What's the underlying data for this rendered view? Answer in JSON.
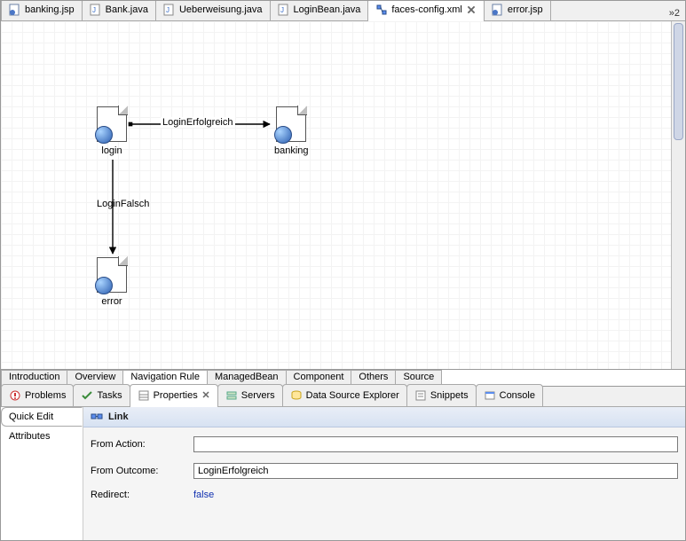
{
  "editorTabs": {
    "overflow": "2",
    "items": [
      {
        "label": "banking.jsp",
        "icon": "jsp-icon",
        "active": false,
        "hasClose": false
      },
      {
        "label": "Bank.java",
        "icon": "java-icon",
        "active": false,
        "hasClose": false
      },
      {
        "label": "Ueberweisung.java",
        "icon": "java-icon",
        "active": false,
        "hasClose": false
      },
      {
        "label": "LoginBean.java",
        "icon": "java-icon",
        "active": false,
        "hasClose": false
      },
      {
        "label": "faces-config.xml",
        "icon": "faces-icon",
        "active": true,
        "hasClose": true
      },
      {
        "label": "error.jsp",
        "icon": "jsp-icon",
        "active": false,
        "hasClose": false
      }
    ]
  },
  "diagram": {
    "nodes": {
      "login": {
        "label": "login"
      },
      "banking": {
        "label": "banking"
      },
      "error": {
        "label": "error"
      }
    },
    "edges": {
      "loginToBanking": {
        "label": "LoginErfolgreich"
      },
      "loginToError": {
        "label": "LoginFalsch"
      }
    }
  },
  "subTabs": [
    {
      "label": "Introduction",
      "active": false
    },
    {
      "label": "Overview",
      "active": false
    },
    {
      "label": "Navigation Rule",
      "active": true
    },
    {
      "label": "ManagedBean",
      "active": false
    },
    {
      "label": "Component",
      "active": false
    },
    {
      "label": "Others",
      "active": false
    },
    {
      "label": "Source",
      "active": false
    }
  ],
  "viewTabs": [
    {
      "label": "Problems",
      "icon": "problems-icon",
      "active": false
    },
    {
      "label": "Tasks",
      "icon": "tasks-icon",
      "active": false
    },
    {
      "label": "Properties",
      "icon": "properties-icon",
      "active": true,
      "hasClose": true
    },
    {
      "label": "Servers",
      "icon": "servers-icon",
      "active": false
    },
    {
      "label": "Data Source Explorer",
      "icon": "dse-icon",
      "active": false
    },
    {
      "label": "Snippets",
      "icon": "snippets-icon",
      "active": false
    },
    {
      "label": "Console",
      "icon": "console-icon",
      "active": false
    }
  ],
  "properties": {
    "sideTabs": {
      "quickEdit": "Quick Edit",
      "attributes": "Attributes"
    },
    "title": "Link",
    "fields": {
      "fromActionLabel": "From Action:",
      "fromActionValue": "",
      "fromOutcomeLabel": "From Outcome:",
      "fromOutcomeValue": "LoginErfolgreich",
      "redirectLabel": "Redirect:",
      "redirectValue": "false"
    }
  }
}
